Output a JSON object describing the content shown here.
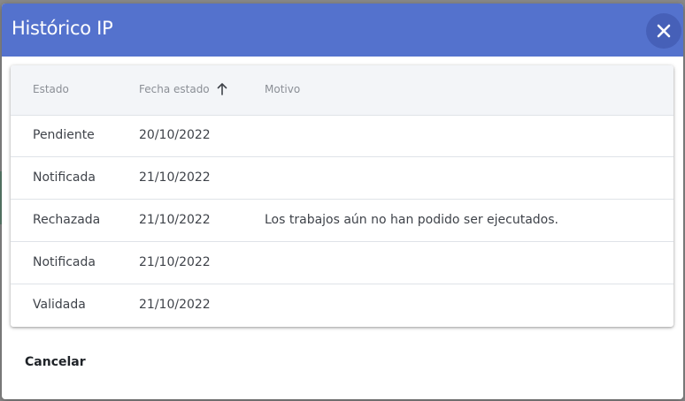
{
  "dialog": {
    "title": "Histórico IP",
    "close_icon": "close-icon",
    "header_color": "#5472cd"
  },
  "table": {
    "headers": {
      "estado": "Estado",
      "fecha": "Fecha estado",
      "motivo": "Motivo"
    },
    "sort_icon": "arrow-up-icon",
    "rows": [
      {
        "estado": "Pendiente",
        "fecha": "20/10/2022",
        "motivo": ""
      },
      {
        "estado": "Notificada",
        "fecha": "21/10/2022",
        "motivo": ""
      },
      {
        "estado": "Rechazada",
        "fecha": "21/10/2022",
        "motivo": "Los trabajos aún no han podido ser ejecutados."
      },
      {
        "estado": "Notificada",
        "fecha": "21/10/2022",
        "motivo": ""
      },
      {
        "estado": "Validada",
        "fecha": "21/10/2022",
        "motivo": ""
      }
    ]
  },
  "footer": {
    "cancel_label": "Cancelar"
  }
}
